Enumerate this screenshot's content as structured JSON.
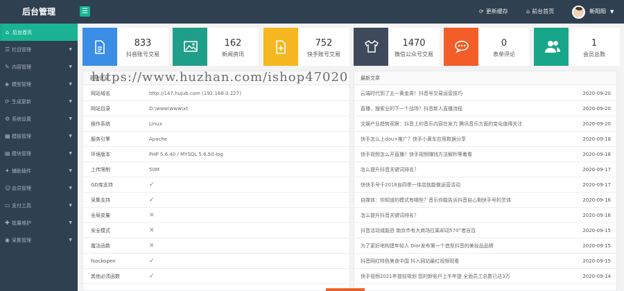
{
  "header": {
    "title": "后台管理",
    "actions": [
      {
        "label": "更新缓存",
        "icon": "refresh-icon"
      },
      {
        "label": "前台首页",
        "icon": "home-icon"
      }
    ],
    "user": {
      "name": "新阳阳"
    }
  },
  "sidebar": {
    "items": [
      {
        "label": "后台首页",
        "icon": "home-icon",
        "active": true
      },
      {
        "label": "栏目管理",
        "icon": "list-icon"
      },
      {
        "label": "内容管理",
        "icon": "edit-icon"
      },
      {
        "label": "模型管理",
        "icon": "cube-icon"
      },
      {
        "label": "生成更新",
        "icon": "refresh-icon"
      },
      {
        "label": "系统设置",
        "icon": "gear-icon"
      },
      {
        "label": "模板管理",
        "icon": "template-icon"
      },
      {
        "label": "模块管理",
        "icon": "module-icon"
      },
      {
        "label": "辅助插件",
        "icon": "plugin-icon"
      },
      {
        "label": "会员管理",
        "icon": "user-icon"
      },
      {
        "label": "支付工具",
        "icon": "card-icon"
      },
      {
        "label": "批量维护",
        "icon": "tools-icon"
      },
      {
        "label": "采集管理",
        "icon": "collect-icon"
      }
    ]
  },
  "stats": [
    {
      "value": "833",
      "label": "抖音账号交易",
      "color": "#3a8ee6",
      "icon": "document-icon"
    },
    {
      "value": "162",
      "label": "新闻资讯",
      "color": "#1f9e89",
      "icon": "image-icon"
    },
    {
      "value": "752",
      "label": "快手账号交易",
      "color": "#f5b820",
      "icon": "file-add-icon"
    },
    {
      "value": "1470",
      "label": "微信公众号交易",
      "color": "#3e4a5b",
      "icon": "shirt-icon"
    },
    {
      "value": "0",
      "label": "表单评论",
      "color": "#f35d28",
      "icon": "comment-icon"
    },
    {
      "value": "1",
      "label": "会员总数",
      "color": "#17a689",
      "icon": "users-icon"
    }
  ],
  "sysinfo": {
    "title": "系统信息",
    "rows": [
      {
        "key": "网站域名",
        "value": "http://147.hujub.com (192.168.0.227)"
      },
      {
        "key": "网站目录",
        "value": "D:\\www\\www\\xt"
      },
      {
        "key": "操作系统",
        "value": "Linux"
      },
      {
        "key": "服务引擎",
        "value": "Apache"
      },
      {
        "key": "环境版本",
        "value": "PHP 5.6.40 / MYSQL 5.6.50-log"
      },
      {
        "key": "上传限制",
        "value": "50M"
      },
      {
        "key": "GD库支持",
        "value": "✓"
      },
      {
        "key": "采集支持",
        "value": "✓"
      },
      {
        "key": "全局变量",
        "value": "✕"
      },
      {
        "key": "安全模式",
        "value": "✕"
      },
      {
        "key": "魔法函数",
        "value": "✕"
      },
      {
        "key": "fsockopen",
        "value": "✓"
      },
      {
        "key": "其他必须函数",
        "value": "✓"
      }
    ]
  },
  "articles": {
    "title": "最新文章",
    "rows": [
      {
        "title": "云端时代到了五一黄金周！抖音号交易运营技巧",
        "date": "2020-09-20"
      },
      {
        "title": "直播，搜索业的下一个战场？抖音新人直播流程",
        "date": "2020-09-20"
      },
      {
        "title": "文娱产业趋势观察：抖音上的音乐内容在发力 腾讯音乐方面的变化值得关注",
        "date": "2020-09-20"
      },
      {
        "title": "快手怎么上dou+推广？快手小黄车应用数据分享",
        "date": "2020-09-18"
      },
      {
        "title": "快手视频怎么开直播？快手视频赚钱方法解析等着看",
        "date": "2020-09-18"
      },
      {
        "title": "怎么提升抖音关键词排名？",
        "date": "2020-09-17"
      },
      {
        "title": "快快手号千2018自四季一体店就能做运营活动",
        "date": "2020-09-17"
      },
      {
        "title": "自媒体：你知道的模式有哪些？音乐你能告诉抖音自心剩快手号的灵体",
        "date": "2020-09-16"
      },
      {
        "title": "怎么提升抖音关键词排名？",
        "date": "2020-09-16"
      },
      {
        "title": "抖音活动或能恐 南京市有大商场拉离却动570°者自百",
        "date": "2020-09-15"
      },
      {
        "title": "为了更好地构建年轻人 Dior发布第一个造型抖音的美妆品品牌",
        "date": "2020-09-15"
      },
      {
        "title": "抖音网红特色美食中国 抖入网站最红视频观看",
        "date": "2020-09-15"
      },
      {
        "title": "快手视频2021年提前规划 您的新账户上半年提 全面员工总数已达3万",
        "date": "2020-09-14"
      }
    ]
  },
  "watermark": "https://www.huzhan.com/ishop47020"
}
